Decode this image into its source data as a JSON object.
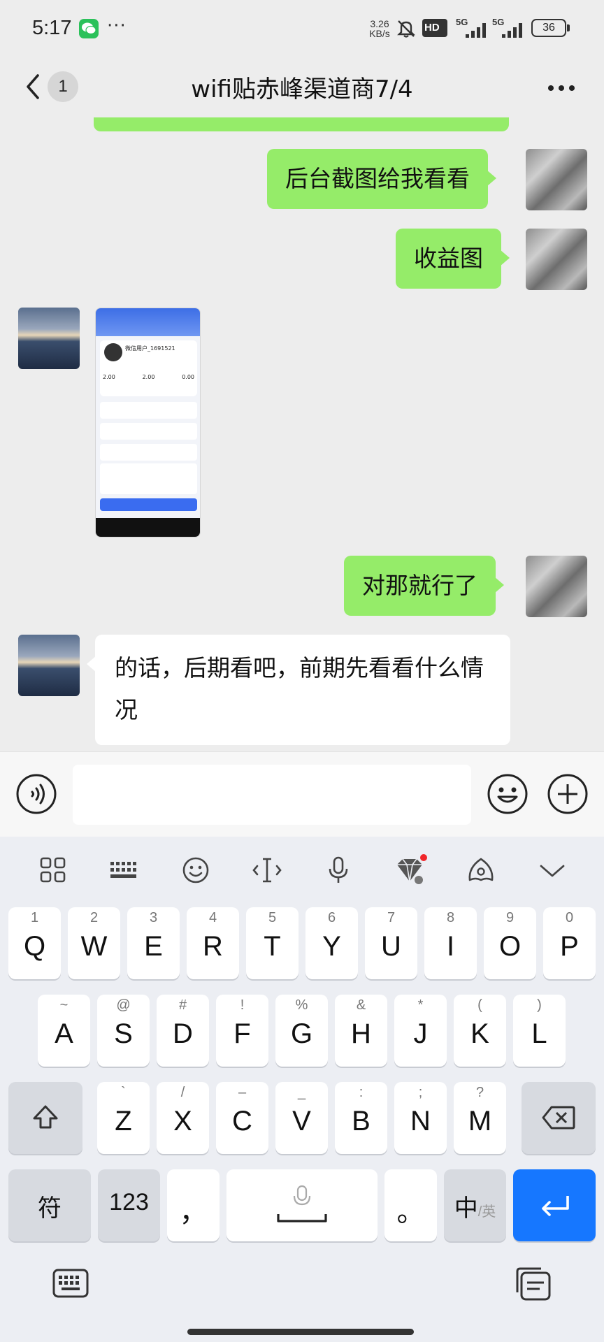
{
  "status_bar": {
    "time": "5:17",
    "dots": "···",
    "net_speed_value": "3.26",
    "net_speed_unit": "KB/s",
    "hd": "HD",
    "sim1": "5G",
    "sim2": "5G",
    "battery": "36"
  },
  "header": {
    "unread": "1",
    "title": "wifi贴赤峰渠道商7/4"
  },
  "messages": [
    {
      "side": "right",
      "text": "后台截图给我看看"
    },
    {
      "side": "right",
      "text": "收益图"
    },
    {
      "side": "left",
      "type": "image"
    },
    {
      "side": "right",
      "text": "对那就行了"
    },
    {
      "side": "left",
      "text": "的话，后期看吧，前期先看看什么情况"
    }
  ],
  "thumbnail": {
    "user_name": "微信用户_1691521",
    "stats": [
      "2.00",
      "2.00",
      "0.00"
    ]
  },
  "input": {
    "placeholder": ""
  },
  "keyboard": {
    "row1": [
      {
        "sub": "1",
        "main": "Q"
      },
      {
        "sub": "2",
        "main": "W"
      },
      {
        "sub": "3",
        "main": "E"
      },
      {
        "sub": "4",
        "main": "R"
      },
      {
        "sub": "5",
        "main": "T"
      },
      {
        "sub": "6",
        "main": "Y"
      },
      {
        "sub": "7",
        "main": "U"
      },
      {
        "sub": "8",
        "main": "I"
      },
      {
        "sub": "9",
        "main": "O"
      },
      {
        "sub": "0",
        "main": "P"
      }
    ],
    "row2": [
      {
        "sub": "~",
        "main": "A"
      },
      {
        "sub": "@",
        "main": "S"
      },
      {
        "sub": "#",
        "main": "D"
      },
      {
        "sub": "!",
        "main": "F"
      },
      {
        "sub": "%",
        "main": "G"
      },
      {
        "sub": "&",
        "main": "H"
      },
      {
        "sub": "*",
        "main": "J"
      },
      {
        "sub": "(",
        "main": "K"
      },
      {
        "sub": ")",
        "main": "L"
      }
    ],
    "row3": [
      {
        "sub": "`",
        "main": "Z"
      },
      {
        "sub": "/",
        "main": "X"
      },
      {
        "sub": "–",
        "main": "C"
      },
      {
        "sub": "_",
        "main": "V"
      },
      {
        "sub": ":",
        "main": "B"
      },
      {
        "sub": ";",
        "main": "N"
      },
      {
        "sub": "?",
        "main": "M"
      }
    ],
    "symbols_label": "符",
    "numbers_label": "123",
    "comma_label": "，",
    "period_label": "。",
    "lang_main": "中",
    "lang_sub": "/英"
  }
}
